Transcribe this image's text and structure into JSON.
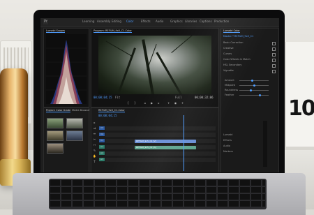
{
  "app": {
    "logo": "Pr",
    "workspaces": [
      "Learning",
      "Assembly",
      "Editing",
      "Color",
      "Effects",
      "Audio",
      "Graphics",
      "Libraries",
      "Captions",
      "Production"
    ],
    "active_workspace": "Color"
  },
  "scopes": {
    "tab": "Lumetri Scopes"
  },
  "program_monitor": {
    "title": "Program: REFILM_9x5_C1-Color",
    "timecode_left": "00;00;04;15",
    "timecode_right": "00;00;32;06",
    "fit": "Fit",
    "resolution": "Full"
  },
  "lumetri": {
    "title": "Lumetri Color",
    "master_label": "Master * REFILM_9x5_C1",
    "sections": [
      "Basic Correction",
      "Creative",
      "Curves",
      "Color Wheels & Match",
      "HSL Secondary",
      "Vignette"
    ],
    "sliders": [
      {
        "label": "Amount",
        "value": 0.45
      },
      {
        "label": "Midpoint",
        "value": 0.5
      },
      {
        "label": "Roundness",
        "value": 0.4
      },
      {
        "label": "Feather",
        "value": 0.7
      }
    ],
    "footer": [
      "Lumetri",
      "Effects",
      "Audio",
      "Markers"
    ]
  },
  "project": {
    "tab": "Project: Color Grade",
    "tab2": "Media Browser"
  },
  "timeline": {
    "title": "REFILM_9x5_C1-Color",
    "timecode": "00;00;04;15",
    "tracks": [
      "V3",
      "V2",
      "V1",
      "A1",
      "A2",
      "A3"
    ],
    "clips": [
      {
        "label": "REFILM_9x5_C1 [V]",
        "color": "#6a8fd6"
      },
      {
        "label": "REFILM_9x5_C1 [A]",
        "color": "#5fa58f"
      }
    ]
  },
  "colors": {
    "accent": "#4d9cff",
    "panel_bg": "#1a1a1a"
  }
}
